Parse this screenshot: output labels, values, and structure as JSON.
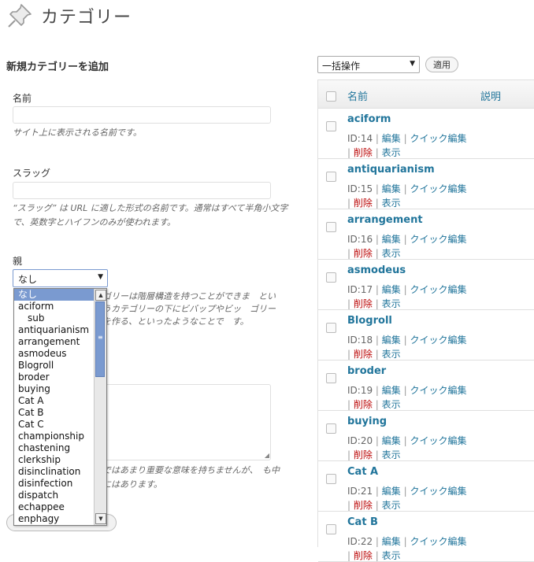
{
  "page": {
    "title": "カテゴリー"
  },
  "form": {
    "heading": "新規カテゴリーを追加",
    "name": {
      "label": "名前",
      "value": "",
      "hint": "サイト上に表示される名前です。"
    },
    "slug": {
      "label": "スラッグ",
      "value": "",
      "hint": "“スラッグ” は URL に適した形式の名前です。通常はすべて半角小文字で、英数字とハイフンのみが使われます。"
    },
    "parent": {
      "label": "親",
      "selected": "なし",
      "hint": "ゴリーは階層構造を持つことができま　というカテゴリーの下にビバップやビッ　ゴリーを作る、といったようなことで　す。",
      "options": [
        {
          "label": "なし",
          "selected": true,
          "indent": false
        },
        {
          "label": "aciform",
          "selected": false,
          "indent": false
        },
        {
          "label": "sub",
          "selected": false,
          "indent": true
        },
        {
          "label": "antiquarianism",
          "selected": false,
          "indent": false
        },
        {
          "label": "arrangement",
          "selected": false,
          "indent": false
        },
        {
          "label": "asmodeus",
          "selected": false,
          "indent": false
        },
        {
          "label": "Blogroll",
          "selected": false,
          "indent": false
        },
        {
          "label": "broder",
          "selected": false,
          "indent": false
        },
        {
          "label": "buying",
          "selected": false,
          "indent": false
        },
        {
          "label": "Cat A",
          "selected": false,
          "indent": false
        },
        {
          "label": "Cat B",
          "selected": false,
          "indent": false
        },
        {
          "label": "Cat C",
          "selected": false,
          "indent": false
        },
        {
          "label": "championship",
          "selected": false,
          "indent": false
        },
        {
          "label": "chastening",
          "selected": false,
          "indent": false
        },
        {
          "label": "clerkship",
          "selected": false,
          "indent": false
        },
        {
          "label": "disinclination",
          "selected": false,
          "indent": false
        },
        {
          "label": "disinfection",
          "selected": false,
          "indent": false
        },
        {
          "label": "dispatch",
          "selected": false,
          "indent": false
        },
        {
          "label": "echappee",
          "selected": false,
          "indent": false
        },
        {
          "label": "enphagy",
          "selected": false,
          "indent": false
        }
      ]
    },
    "description": {
      "value": "",
      "hint": "ではあまり重要な意味を持ちませんが、　も中にはあります。"
    }
  },
  "bulk": {
    "selected": "一括操作",
    "apply_label": "適用"
  },
  "table": {
    "col_name": "名前",
    "col_description": "説明",
    "actions": {
      "edit": "編集",
      "quick_edit": "クイック編集",
      "delete": "削除",
      "view": "表示"
    },
    "rows": [
      {
        "name": "aciform",
        "id": "ID:14"
      },
      {
        "name": "antiquarianism",
        "id": "ID:15"
      },
      {
        "name": "arrangement",
        "id": "ID:16"
      },
      {
        "name": "asmodeus",
        "id": "ID:17"
      },
      {
        "name": "Blogroll",
        "id": "ID:18"
      },
      {
        "name": "broder",
        "id": "ID:19"
      },
      {
        "name": "buying",
        "id": "ID:20"
      },
      {
        "name": "Cat A",
        "id": "ID:21"
      },
      {
        "name": "Cat B",
        "id": "ID:22"
      }
    ]
  },
  "colors": {
    "link": "#21759b",
    "delete": "#bc0b0b",
    "select_highlight": "#7a9ad0"
  }
}
